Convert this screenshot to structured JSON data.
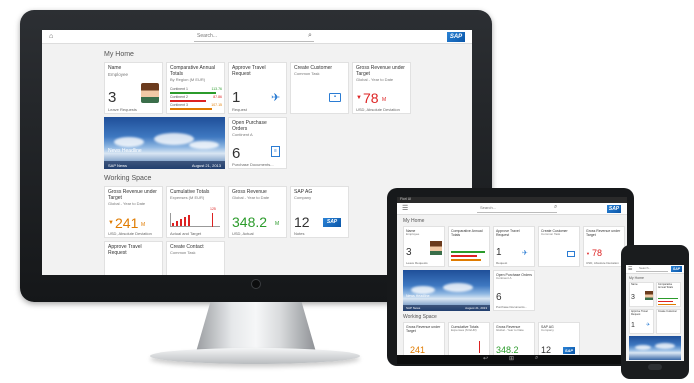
{
  "shell": {
    "search_placeholder": "Search...",
    "logo": "SAP",
    "tablet_title": "Fiori UI"
  },
  "sections": {
    "my_home": "My Home",
    "working_space": "Working Space"
  },
  "tiles": {
    "employee": {
      "title": "Name",
      "subtitle": "Employee",
      "value": "3",
      "footer": "Leave Requests"
    },
    "comparative": {
      "title": "Comparative Annual Totals",
      "subtitle": "By Region (M EUR)",
      "rows": [
        {
          "label": "Continent 1",
          "value": "113.76"
        },
        {
          "label": "Continent 2",
          "value": "87.86"
        },
        {
          "label": "Continent 3",
          "value": "107.15"
        }
      ]
    },
    "approve_travel": {
      "title": "Approve Travel Request",
      "value": "1",
      "footer": "Request"
    },
    "create_customer": {
      "title": "Create Customer",
      "subtitle": "Common Task"
    },
    "gross_rev_target": {
      "title": "Gross Revenue under Target",
      "subtitle": "Global - Year to Date",
      "value": "78",
      "unit": "M",
      "footer": "USD, Absolute Deviation"
    },
    "news": {
      "headline": "News Headline",
      "source": "SAP News",
      "date": "August 21, 2013"
    },
    "open_po": {
      "title": "Open Purchase Orders",
      "subtitle": "Continent A",
      "value": "6",
      "footer": "Purchase Documents..."
    },
    "gross_rev_target2": {
      "title": "Gross Revenue under Target",
      "subtitle": "Global - Year to Date",
      "value": "241",
      "unit": "M",
      "footer": "USD, Absolute Deviation"
    },
    "cumulative": {
      "title": "Cumulative Totals",
      "subtitle": "Expenses (M EUR)",
      "marker": "125",
      "footer": "Actual and Target"
    },
    "gross_revenue": {
      "title": "Gross Revenue",
      "subtitle": "Global - Year to Date",
      "value": "348.2",
      "unit": "M",
      "footer": "USD, Actual"
    },
    "sap_ag": {
      "title": "SAP AG",
      "subtitle": "Company",
      "value": "12",
      "footer": "Notes"
    },
    "approve_travel2": {
      "title": "Approve Travel Request"
    },
    "create_contact": {
      "title": "Create Contact",
      "subtitle": "Common Task"
    }
  },
  "colors": {
    "accent": "#2b7cd3",
    "negative": "#dd2222",
    "positive": "#2b9b2b"
  }
}
